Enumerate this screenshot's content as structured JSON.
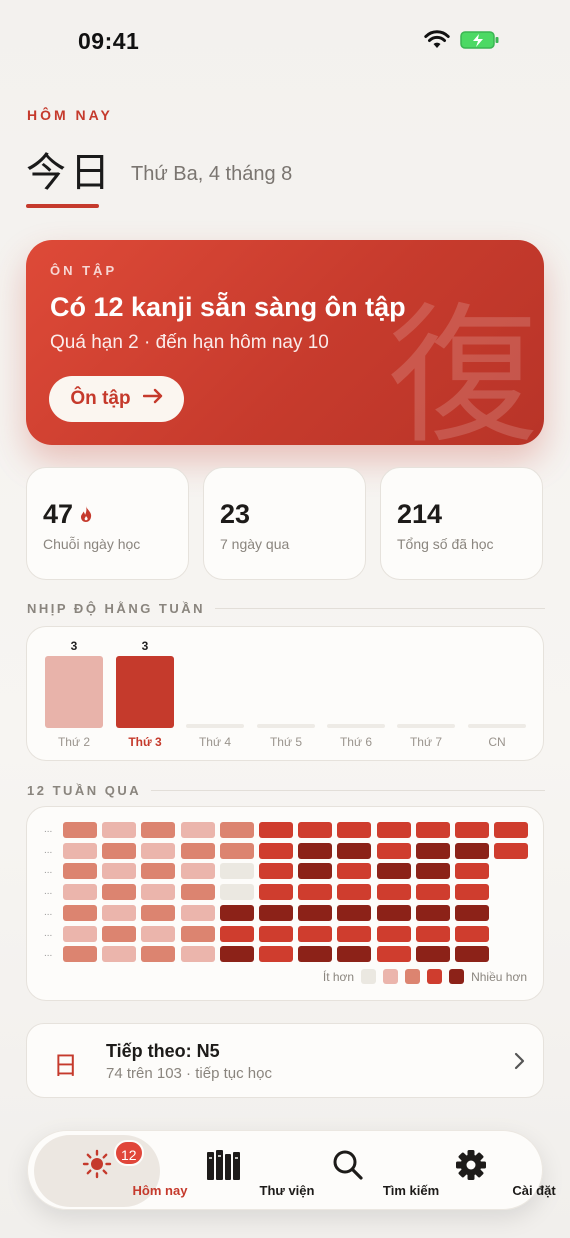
{
  "status_bar": {
    "time": "09:41"
  },
  "header": {
    "eyebrow": "HÔM NAY",
    "kanji": "今日",
    "date": "Thứ Ba, 4 tháng 8"
  },
  "review": {
    "eyebrow": "ÔN TẬP",
    "title": "Có 12 kanji sẵn sàng ôn tập",
    "subtitle": "Quá hạn 2 · đến hạn hôm nay 10",
    "button_label": "Ôn tập",
    "watermark": "復"
  },
  "stats": [
    {
      "value": "47",
      "label": "Chuỗi ngày học",
      "icon": "flame-icon"
    },
    {
      "value": "23",
      "label": "7 ngày qua"
    },
    {
      "value": "214",
      "label": "Tổng số đã học"
    }
  ],
  "weekly": {
    "title": "NHỊP ĐỘ HẰNG TUẦN",
    "days": [
      {
        "label": "Thứ 2",
        "count": "3",
        "value": 3,
        "today": false
      },
      {
        "label": "Thứ 3",
        "count": "3",
        "value": 3,
        "today": true
      },
      {
        "label": "Thứ 4",
        "count": "",
        "value": 0,
        "today": false
      },
      {
        "label": "Thứ 5",
        "count": "",
        "value": 0,
        "today": false
      },
      {
        "label": "Thứ 6",
        "count": "",
        "value": 0,
        "today": false
      },
      {
        "label": "Thứ 7",
        "count": "",
        "value": 0,
        "today": false
      },
      {
        "label": "CN",
        "count": "",
        "value": 0,
        "today": false
      }
    ],
    "max": 3
  },
  "heatmap": {
    "title": "12 TUẦN QUA",
    "row_labels": [
      "...",
      "...",
      "...",
      "...",
      "...",
      "...",
      "..."
    ],
    "levels": [
      [
        3,
        2,
        3,
        2,
        3,
        4,
        4,
        4,
        4,
        4,
        4,
        4
      ],
      [
        2,
        3,
        2,
        3,
        3,
        4,
        5,
        5,
        4,
        5,
        5,
        4
      ],
      [
        3,
        2,
        3,
        2,
        1,
        4,
        5,
        4,
        5,
        5,
        4
      ],
      [
        2,
        3,
        2,
        3,
        1,
        4,
        4,
        4,
        4,
        4,
        4
      ],
      [
        3,
        2,
        3,
        2,
        5,
        5,
        5,
        5,
        5,
        5,
        5
      ],
      [
        2,
        3,
        2,
        3,
        4,
        4,
        4,
        4,
        4,
        4,
        4
      ],
      [
        3,
        2,
        3,
        2,
        5,
        4,
        5,
        5,
        4,
        5,
        5
      ]
    ],
    "legend_less": "Ít hơn",
    "legend_more": "Nhiều hơn",
    "colors": [
      "#ebe8e1",
      "#ebb5ac",
      "#dc8470",
      "#cf3d2e",
      "#8c2218"
    ]
  },
  "next": {
    "kanji": "日",
    "title": "Tiếp theo: N5",
    "subtitle": "74 trên 103 · tiếp tục học"
  },
  "tabs": [
    {
      "label": "Hôm nay",
      "icon": "sun-icon",
      "active": true,
      "badge": "12"
    },
    {
      "label": "Thư viện",
      "icon": "library-books-icon",
      "active": false
    },
    {
      "label": "Tìm kiếm",
      "icon": "search-icon",
      "active": false
    },
    {
      "label": "Cài đặt",
      "icon": "gear-icon",
      "active": false
    }
  ],
  "accent": "#c53a2c"
}
